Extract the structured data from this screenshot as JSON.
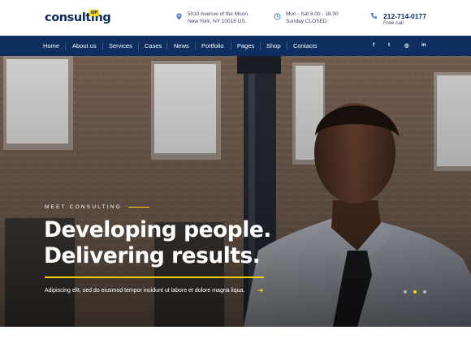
{
  "header": {
    "logo_text": "consulting",
    "logo_badge": "WP",
    "address_line1": "5010 Avenue of the Moon",
    "address_line2": "New York, NY 10018 US.",
    "hours_line1": "Mon - Sat 8.00 - 18.00",
    "hours_line2": "Sunday CLOSED",
    "phone_number": "212-714-0177",
    "phone_caption": "Free call"
  },
  "nav": {
    "items": [
      "Home",
      "About us",
      "Services",
      "Cases",
      "News",
      "Portfolio",
      "Pages",
      "Shop",
      "Contacts"
    ],
    "social": [
      "f",
      "t",
      "◎",
      "in"
    ]
  },
  "hero": {
    "eyebrow": "MEET CONSULTING",
    "headline_line1": "Developing people.",
    "headline_line2": "Delivering results.",
    "subtext": "Adipiscing elit, sed do eiusmod tempor incidunt ut labore et dolore magna liqua.",
    "arrow": "➔",
    "slider_active_index": 1,
    "slider_count": 3
  },
  "colors": {
    "navy": "#0d2e5f",
    "accent": "#f6d20f",
    "icon_blue": "#4a7fd0"
  }
}
